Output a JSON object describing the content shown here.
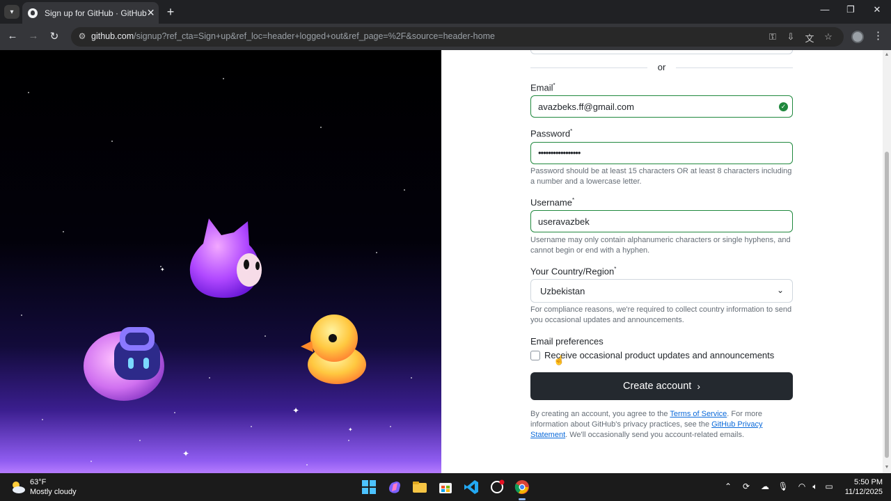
{
  "browser": {
    "tab_title": "Sign up for GitHub · GitHub",
    "tab_close": "✕",
    "new_tab": "+",
    "url_host": "github.com",
    "url_path": "/signup?ref_cta=Sign+up&ref_loc=header+logged+out&ref_page=%2F&source=header-home"
  },
  "form": {
    "divider_text": "or",
    "email_label": "Email",
    "email_value": "avazbeks.ff@gmail.com",
    "password_label": "Password",
    "password_value": "•••••••••••••••••",
    "password_hint": "Password should be at least 15 characters OR at least 8 characters including a number and a lowercase letter.",
    "username_label": "Username",
    "username_value": "useravazbek",
    "username_hint": "Username may only contain alphanumeric characters or single hyphens, and cannot begin or end with a hyphen.",
    "country_label": "Your Country/Region",
    "country_value": "Uzbekistan",
    "country_hint": "For compliance reasons, we're required to collect country information to send you occasional updates and announcements.",
    "email_prefs_title": "Email preferences",
    "email_prefs_checkbox": "Receive occasional product updates and announcements",
    "email_prefs_checked": false,
    "create_button": "Create account",
    "legal_1": "By creating an account, you agree to the ",
    "terms_link": "Terms of Service",
    "legal_2": ". For more information about GitHub's privacy practices, see the ",
    "privacy_link": "GitHub Privacy Statement",
    "legal_3": ". We'll occasionally send you account-related emails.",
    "required_mark": "*"
  },
  "taskbar": {
    "temperature": "63°F",
    "condition": "Mostly cloudy",
    "time": "5:50 PM",
    "date": "11/12/2025"
  },
  "colors": {
    "success_green": "#1f883d",
    "button_dark": "#24292f",
    "link_blue": "#0969da"
  },
  "icons": [
    "github-icon",
    "back-arrow-icon",
    "forward-arrow-icon",
    "reload-icon",
    "site-info-icon",
    "password-key-icon",
    "install-app-icon",
    "translate-icon",
    "bookmark-star-icon",
    "check-circle-icon",
    "chevron-down-icon",
    "chevron-right-icon",
    "windows-start-icon",
    "wifi-icon",
    "volume-icon",
    "battery-icon"
  ]
}
